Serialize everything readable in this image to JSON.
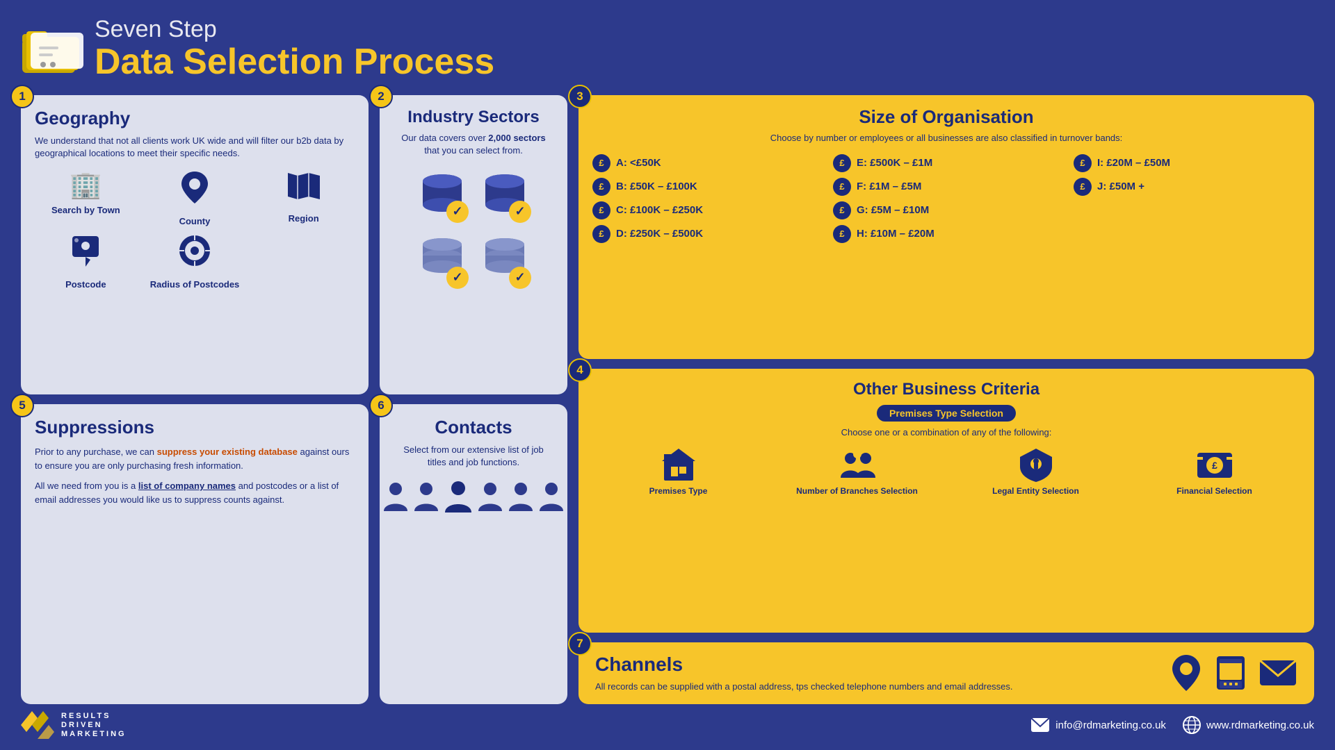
{
  "header": {
    "line1": "Seven Step",
    "line2": "Data Selection Process",
    "icon_label": "folder-icon"
  },
  "steps": {
    "step1": {
      "number": "1",
      "title": "Geography",
      "description": "We understand that not all clients work UK wide and will filter our b2b data by geographical locations to meet their specific needs.",
      "geo_options": [
        {
          "label": "Search by Town",
          "icon": "🏢"
        },
        {
          "label": "County",
          "icon": "📍"
        },
        {
          "label": "Region",
          "icon": "🗺"
        },
        {
          "label": "Postcode",
          "icon": "📌"
        },
        {
          "label": "Radius of Postcodes",
          "icon": "🔵"
        }
      ]
    },
    "step2": {
      "number": "2",
      "title": "Industry Sectors",
      "description_pre": "Our data covers over ",
      "description_bold": "2,000 sectors",
      "description_post": " that you can select from."
    },
    "step3": {
      "number": "3",
      "title": "Size of Organisation",
      "subtitle": "Choose by number or employees or all businesses are also classified in turnover bands:",
      "bands": [
        {
          "label": "A: <£50K"
        },
        {
          "label": "E: £500K – £1M"
        },
        {
          "label": "I: £20M – £50M"
        },
        {
          "label": "B: £50K – £100K"
        },
        {
          "label": "F: £1M – £5M"
        },
        {
          "label": "J: £50M +"
        },
        {
          "label": "C: £100K – £250K"
        },
        {
          "label": "G: £5M – £10M"
        },
        {
          "label": ""
        },
        {
          "label": "D: £250K – £500K"
        },
        {
          "label": "H: £10M – £20M"
        },
        {
          "label": ""
        }
      ]
    },
    "step4": {
      "number": "4",
      "title": "Other Business Criteria",
      "badge_label": "Premises Type Selection",
      "description": "Choose one or a combination of any of the following:",
      "criteria": [
        {
          "label": "Premises Type",
          "icon": "🏢"
        },
        {
          "label": "Number of Branches Selection",
          "icon": "👥"
        },
        {
          "label": "Legal Entity Selection",
          "icon": "🔑"
        },
        {
          "label": "Financial Selection",
          "icon": "💰"
        }
      ]
    },
    "step5": {
      "number": "5",
      "title": "Suppressions",
      "para1": "Prior to any purchase, we can ",
      "para1_highlight": "suppress your existing database",
      "para1_end": " against ours to ensure you are only purchasing fresh information.",
      "para2_pre": "All we need from you is a ",
      "para2_highlight": "list of company names",
      "para2_end": " and postcodes or a list of email addresses you would like us to suppress counts against."
    },
    "step6": {
      "number": "6",
      "title": "Contacts",
      "description": "Select from our extensive list of job titles and job functions.",
      "person_count": 6
    },
    "step7": {
      "number": "7",
      "title": "Channels",
      "description": "All records can be supplied with a postal address, tps checked telephone numbers and email addresses.",
      "channel_icons": [
        "📍",
        "📞",
        "✉"
      ]
    }
  },
  "footer": {
    "brand_lines": [
      "RESULTS",
      "DRIVEN",
      "MARKETING"
    ],
    "email": "info@rdmarketing.co.uk",
    "website": "www.rdmarketing.co.uk",
    "email_label": "info@rdmarketing.co.uk",
    "website_label": "www.rdmarketing.co.uk"
  }
}
